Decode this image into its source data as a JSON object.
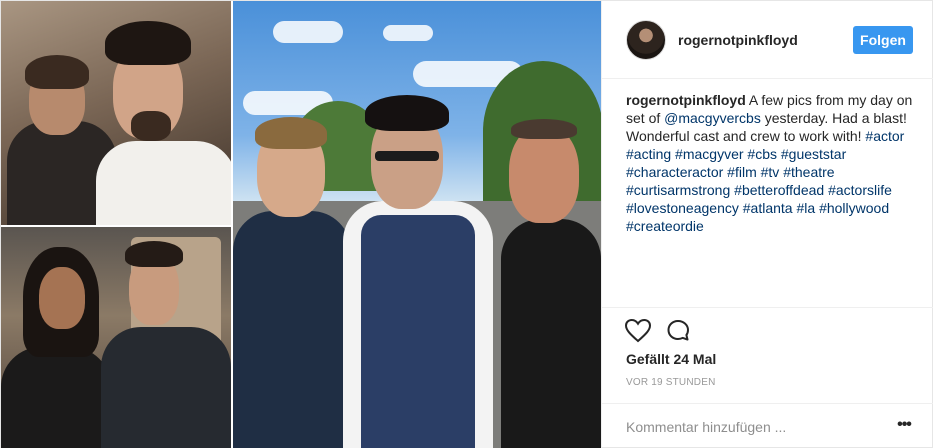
{
  "post": {
    "photo_alt": "Collage of photos from the set",
    "author": {
      "username": "rogernotpinkfloyd",
      "avatar_icon": "profile-avatar"
    },
    "follow_label": "Folgen",
    "caption": {
      "username": "rogernotpinkfloyd",
      "text_before_mention": " A few pics from my day on set of ",
      "mention": "@macgyvercbs",
      "text_after_mention": " yesterday. Had a blast! Wonderful cast and crew to work with! ",
      "hashtags": [
        "#actor",
        "#acting",
        "#macgyver",
        "#cbs",
        "#gueststar",
        "#characteractor",
        "#film",
        "#tv",
        "#theatre",
        "#curtisarmstrong",
        "#betteroffdead",
        "#actorslife",
        "#lovestoneagency",
        "#atlanta",
        "#la",
        "#hollywood",
        "#createordie"
      ]
    },
    "actions": {
      "like_icon": "heart-icon",
      "comment_icon": "comment-icon"
    },
    "likes_text": "Gefällt 24 Mal",
    "timestamp": "VOR 19 STUNDEN",
    "comment": {
      "placeholder": "Kommentar hinzufügen ...",
      "more_icon": "more-options-icon"
    }
  },
  "colors": {
    "accent": "#3897f0",
    "link": "#003569",
    "text": "#262626",
    "muted": "#999999",
    "border": "#efefef"
  }
}
